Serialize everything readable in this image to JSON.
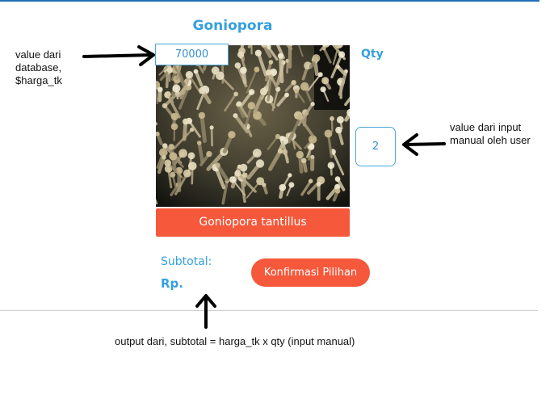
{
  "product": {
    "title": "Goniopora",
    "price_value": "70000",
    "name_label": "Goniopora tantillus",
    "image_alt": "Goniopora coral"
  },
  "qty": {
    "label": "Qty",
    "value": "2"
  },
  "subtotal": {
    "label": "Subtotal:",
    "currency": "Rp."
  },
  "actions": {
    "confirm_label": "Konfirmasi Pilihan"
  },
  "annotations": {
    "price_note": "value dari database, $harga_tk",
    "qty_note": "value dari input manual oleh user",
    "subtotal_note": "output dari, subtotal = harga_tk x qty (input manual)"
  },
  "colors": {
    "accent_blue": "#35a0dd",
    "accent_orange": "#f5583a",
    "top_rule": "#1f6fb8"
  }
}
